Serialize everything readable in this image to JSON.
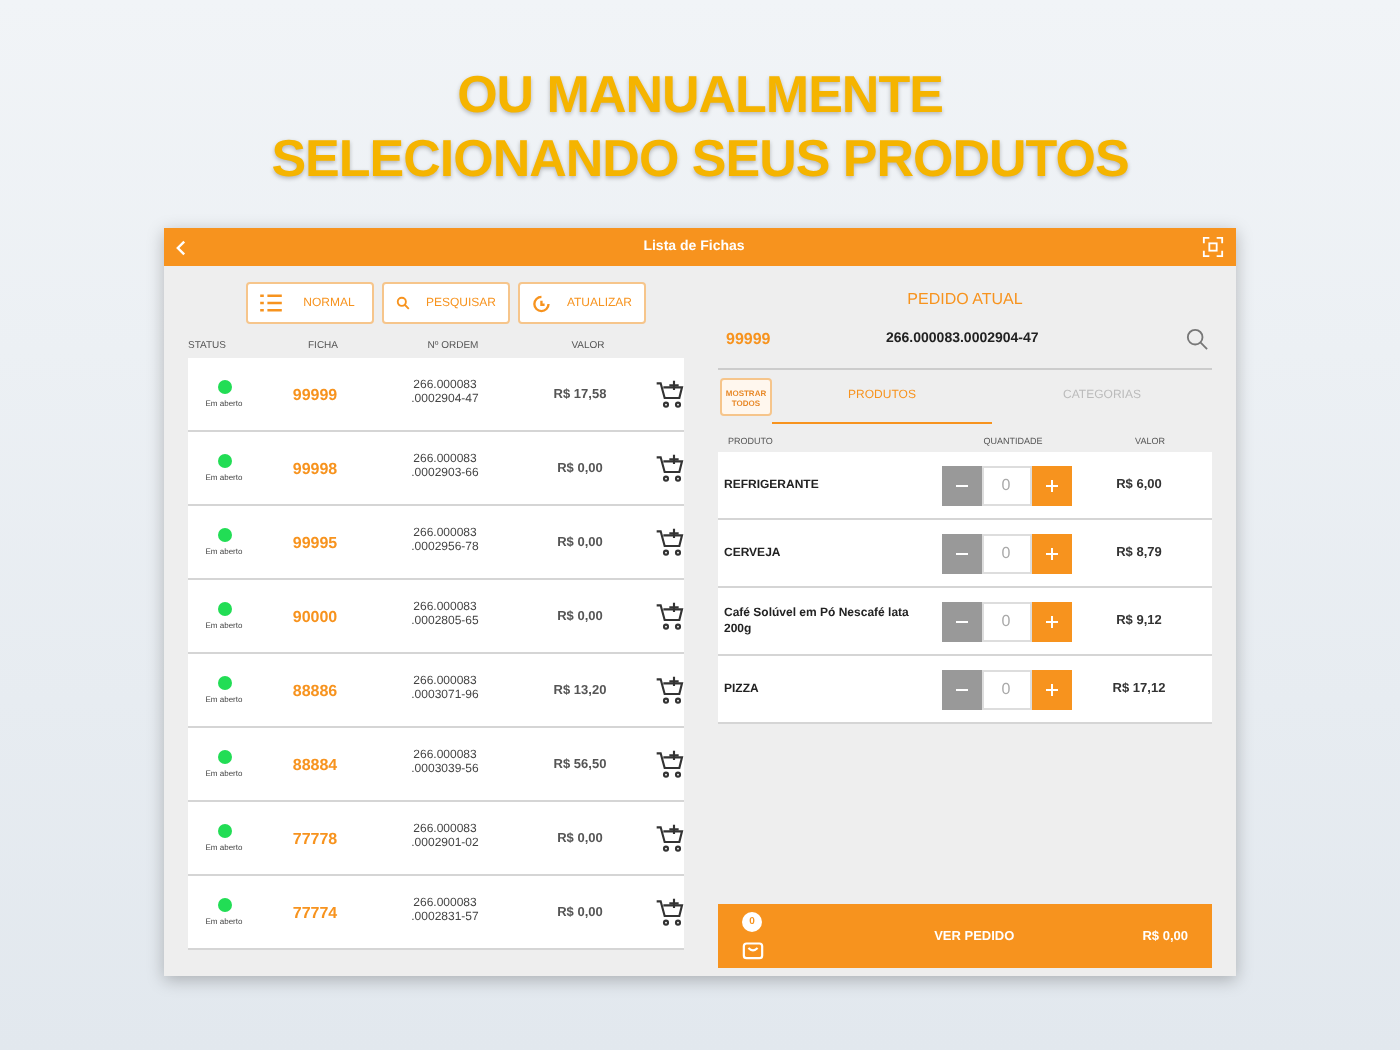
{
  "headline": [
    "OU MANUALMENTE",
    "SELECIONANDO SEUS PRODUTOS"
  ],
  "window": {
    "title": "Lista de Fichas"
  },
  "toolbar": [
    {
      "label": "NORMAL",
      "kind": "list"
    },
    {
      "label": "PESQUISAR",
      "kind": "search"
    },
    {
      "label": "ATUALIZAR",
      "kind": "refresh"
    }
  ],
  "orders": {
    "columns": [
      "STATUS",
      "FICHA",
      "Nº ORDEM",
      "VALOR"
    ],
    "rows": [
      {
        "status": "Em aberto",
        "ficha": "99999",
        "ordem": [
          "266.000083",
          ".0002904-47"
        ],
        "valor": "R$ 17,58"
      },
      {
        "status": "Em aberto",
        "ficha": "99998",
        "ordem": [
          "266.000083",
          ".0002903-66"
        ],
        "valor": "R$ 0,00"
      },
      {
        "status": "Em aberto",
        "ficha": "99995",
        "ordem": [
          "266.000083",
          ".0002956-78"
        ],
        "valor": "R$ 0,00"
      },
      {
        "status": "Em aberto",
        "ficha": "90000",
        "ordem": [
          "266.000083",
          ".0002805-65"
        ],
        "valor": "R$ 0,00"
      },
      {
        "status": "Em aberto",
        "ficha": "88886",
        "ordem": [
          "266.000083",
          ".0003071-96"
        ],
        "valor": "R$ 13,20"
      },
      {
        "status": "Em aberto",
        "ficha": "88884",
        "ordem": [
          "266.000083",
          ".0003039-56"
        ],
        "valor": "R$ 56,50"
      },
      {
        "status": "Em aberto",
        "ficha": "77778",
        "ordem": [
          "266.000083",
          ".0002901-02"
        ],
        "valor": "R$ 0,00"
      },
      {
        "status": "Em aberto",
        "ficha": "77774",
        "ordem": [
          "266.000083",
          ".0002831-57"
        ],
        "valor": "R$ 0,00"
      }
    ]
  },
  "current_order": {
    "title": "PEDIDO ATUAL",
    "ficha": "99999",
    "ordem": "266.000083.0002904-47"
  },
  "show_all": "MOSTRAR TODOS",
  "tabs": [
    {
      "label": "PRODUTOS",
      "selected": true
    },
    {
      "label": "CATEGORIAS",
      "selected": false
    }
  ],
  "products": {
    "columns": [
      "PRODUTO",
      "QUANTIDADE",
      "VALOR"
    ],
    "rows": [
      {
        "name": "REFRIGERANTE",
        "qty": "0",
        "valor": "R$ 6,00"
      },
      {
        "name": "CERVEJA",
        "qty": "0",
        "valor": "R$ 8,79"
      },
      {
        "name": "Café Solúvel em Pó Nescafé lata 200g",
        "qty": "0",
        "valor": "R$ 9,12"
      },
      {
        "name": "PIZZA",
        "qty": "0",
        "valor": "R$ 17,12"
      }
    ]
  },
  "footer": {
    "count": "0",
    "label": "VER PEDIDO",
    "total": "R$ 0,00"
  }
}
